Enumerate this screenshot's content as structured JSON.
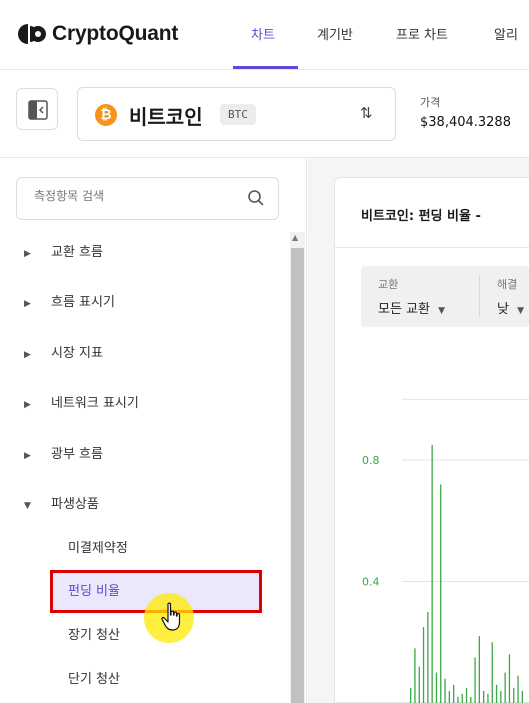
{
  "app": {
    "logo_text": "CryptoQuant"
  },
  "nav": {
    "tabs": [
      {
        "label": "차트"
      },
      {
        "label": "계기반"
      },
      {
        "label": "프로 차트"
      },
      {
        "label": "알리"
      }
    ]
  },
  "asset": {
    "coin_symbol": "₿",
    "name": "비트코인",
    "ticker": "BTC",
    "price_label": "가격",
    "price": "$38,404.3288"
  },
  "sidebar": {
    "search_placeholder": "측정항목 검색",
    "items": [
      {
        "label": "교환 흐름",
        "caret": "▶"
      },
      {
        "label": "흐름 표시기",
        "caret": "▶"
      },
      {
        "label": "시장 지표",
        "caret": "▶"
      },
      {
        "label": "네트워크 표시기",
        "caret": "▶"
      },
      {
        "label": "광부 흐름",
        "caret": "▶"
      },
      {
        "label": "파생상품",
        "caret": "▼"
      }
    ],
    "sub_items": [
      {
        "label": "미결제약정"
      },
      {
        "label": "펀딩 비율"
      },
      {
        "label": "장기 청산"
      },
      {
        "label": "단기 청산"
      }
    ]
  },
  "main": {
    "card_title": "비트코인: 펀딩 비율 - ",
    "filters": [
      {
        "label": "교환",
        "value": "모든 교환"
      },
      {
        "label": "해결",
        "value": "낮"
      }
    ]
  },
  "chart_data": {
    "type": "bar",
    "title": "",
    "xlabel": "",
    "ylabel": "",
    "y_tick_labels": [
      "0.8",
      "0.4"
    ],
    "ylim": [
      0,
      1.1
    ],
    "series": [
      {
        "color": "#3aa845",
        "values": [
          0.05,
          0.18,
          0.12,
          0.25,
          0.3,
          0.85,
          0.1,
          0.72,
          0.08,
          0.04,
          0.06,
          0.02,
          0.03,
          0.05,
          0.02,
          0.15,
          0.22,
          0.04,
          0.03,
          0.2,
          0.06,
          0.04,
          0.1,
          0.16,
          0.05,
          0.09,
          0.04
        ]
      }
    ]
  }
}
